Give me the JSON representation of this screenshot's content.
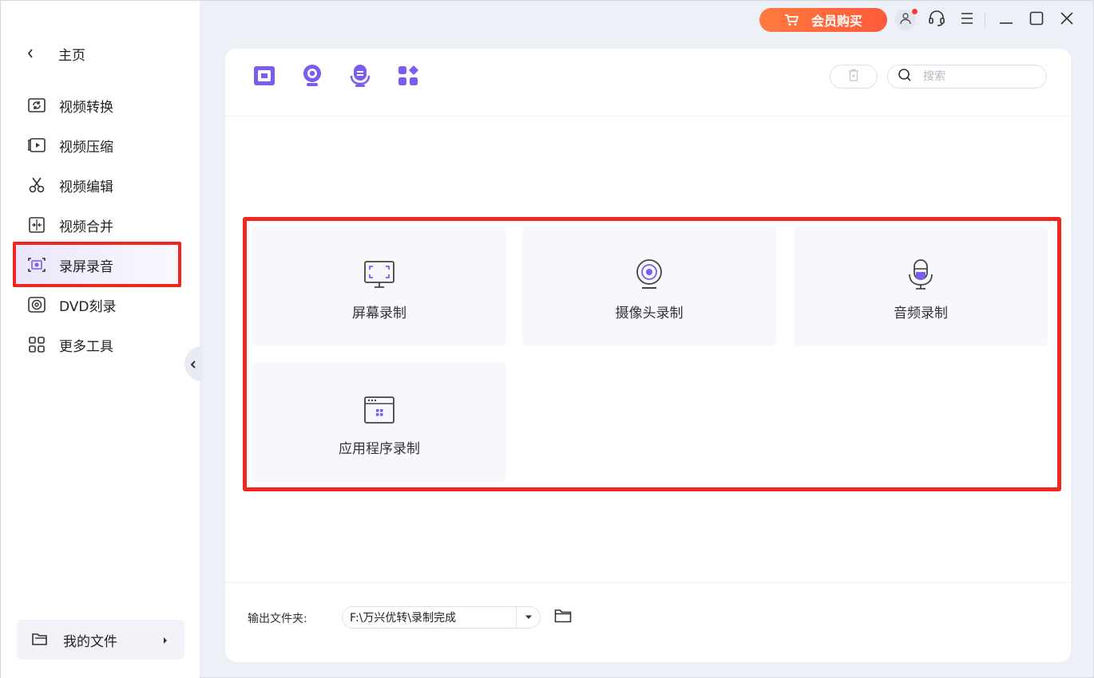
{
  "app": {
    "vip_label": "会员购买",
    "colors": {
      "accent": "#7c5cf0",
      "vip": "#ff6a3d",
      "highlight": "#f1261f"
    }
  },
  "sidebar": {
    "home_label": "主页",
    "items": [
      {
        "label": "视频转换",
        "icon": "video-convert-icon"
      },
      {
        "label": "视频压缩",
        "icon": "video-compress-icon"
      },
      {
        "label": "视频编辑",
        "icon": "scissors-icon"
      },
      {
        "label": "视频合并",
        "icon": "video-merge-icon"
      },
      {
        "label": "录屏录音",
        "icon": "screen-record-icon",
        "active": true
      },
      {
        "label": "DVD刻录",
        "icon": "dvd-icon"
      },
      {
        "label": "更多工具",
        "icon": "grid-tools-icon"
      }
    ],
    "my_files_label": "我的文件"
  },
  "toolbar": {
    "search_placeholder": "搜索"
  },
  "cards": [
    {
      "label": "屏幕录制",
      "icon": "monitor-icon"
    },
    {
      "label": "摄像头录制",
      "icon": "webcam-icon"
    },
    {
      "label": "音频录制",
      "icon": "microphone-icon"
    },
    {
      "label": "应用程序录制",
      "icon": "app-window-icon"
    }
  ],
  "footer": {
    "output_label": "输出文件夹:",
    "output_path": "F:\\万兴优转\\录制完成"
  }
}
